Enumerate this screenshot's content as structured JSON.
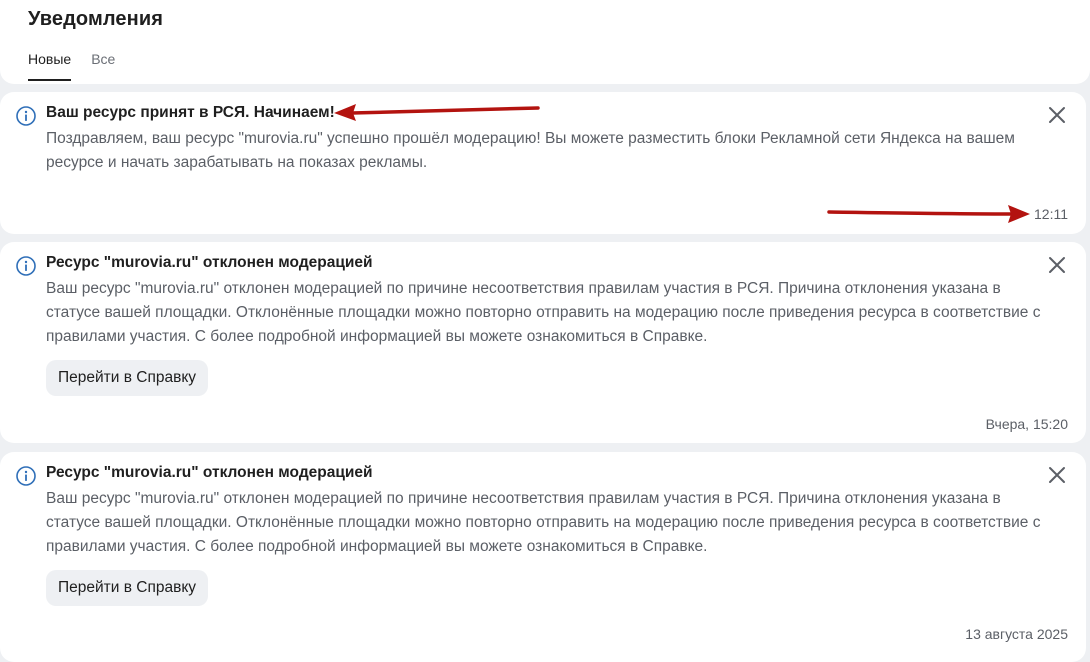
{
  "header": {
    "title": "Уведомления",
    "tabs": [
      {
        "label": "Новые",
        "active": true
      },
      {
        "label": "Все",
        "active": false
      }
    ]
  },
  "notifications": [
    {
      "icon": "info-icon",
      "title": "Ваш ресурс принят в РСЯ. Начинаем!",
      "body": "Поздравляем, ваш ресурс \"murovia.ru\" успешно прошёл модерацию! Вы можете разместить блоки Рекламной сети Яндекса на вашем ресурсе и начать зарабатывать на показах рекламы.",
      "button": "",
      "time": "12:11"
    },
    {
      "icon": "info-icon",
      "title": "Ресурс \"murovia.ru\" отклонен модерацией",
      "body": "Ваш ресурс \"murovia.ru\" отклонен модерацией по причине несоответствия правилам участия в РСЯ. Причина отклонения указана в статусе вашей площадки. Отклонённые площадки можно повторно отправить на модерацию после приведения ресурса в соответствие с правилами участия. С более подробной информацией вы можете ознакомиться в Справке.",
      "button": "Перейти в Справку",
      "time": "Вчера, 15:20"
    },
    {
      "icon": "info-icon",
      "title": "Ресурс \"murovia.ru\" отклонен модерацией",
      "body": "Ваш ресурс \"murovia.ru\" отклонен модерацией по причине несоответствия правилам участия в РСЯ. Причина отклонения указана в статусе вашей площадки. Отклонённые площадки можно повторно отправить на модерацию после приведения ресурса в соответствие с правилами участия. С более подробной информацией вы можете ознакомиться в Справке.",
      "button": "Перейти в Справку",
      "time": "13 августа 2025"
    }
  ],
  "colors": {
    "accent": "#2f6fb8",
    "annotation_arrow": "#b3130f",
    "background": "#eef0f3"
  }
}
